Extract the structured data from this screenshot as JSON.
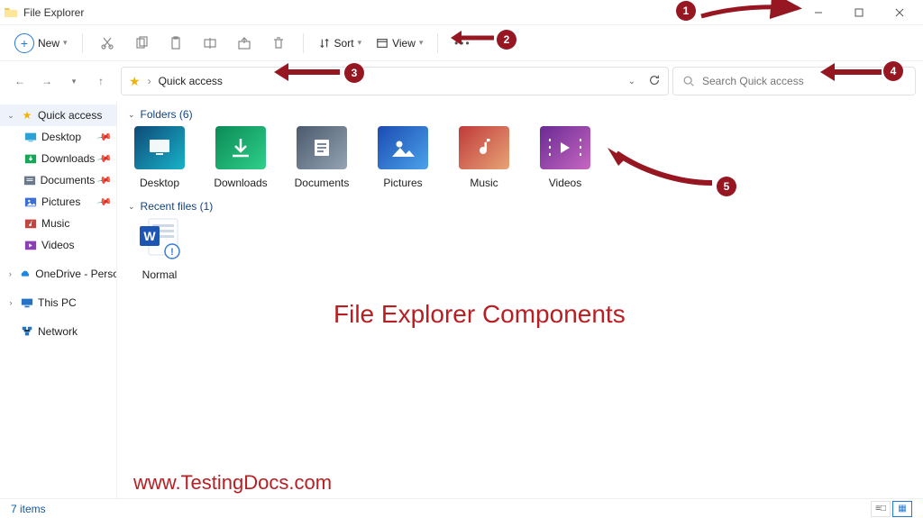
{
  "app": {
    "title": "File Explorer"
  },
  "window_buttons": {
    "min": "—",
    "max": "▢",
    "close": "✕"
  },
  "toolbar": {
    "new_label": "New",
    "sort_label": "Sort",
    "view_label": "View"
  },
  "breadcrumb": {
    "location": "Quick access",
    "sep": "›"
  },
  "search": {
    "placeholder": "Search Quick access"
  },
  "navpane": {
    "quick_access": "Quick access",
    "pinned": [
      {
        "label": "Desktop"
      },
      {
        "label": "Downloads"
      },
      {
        "label": "Documents"
      },
      {
        "label": "Pictures"
      },
      {
        "label": "Music"
      },
      {
        "label": "Videos"
      }
    ],
    "onedrive": "OneDrive - Person",
    "thispc": "This PC",
    "network": "Network"
  },
  "groups": {
    "folders": {
      "label": "Folders (6)",
      "items": [
        {
          "label": "Desktop"
        },
        {
          "label": "Downloads"
        },
        {
          "label": "Documents"
        },
        {
          "label": "Pictures"
        },
        {
          "label": "Music"
        },
        {
          "label": "Videos"
        }
      ]
    },
    "recent": {
      "label": "Recent files (1)",
      "items": [
        {
          "label": "Normal"
        }
      ]
    }
  },
  "status": {
    "text": "7 items"
  },
  "annotations": {
    "n1": "1",
    "n2": "2",
    "n3": "3",
    "n4": "4",
    "n5": "5",
    "heading": "File Explorer Components",
    "watermark": "www.TestingDocs.com"
  }
}
